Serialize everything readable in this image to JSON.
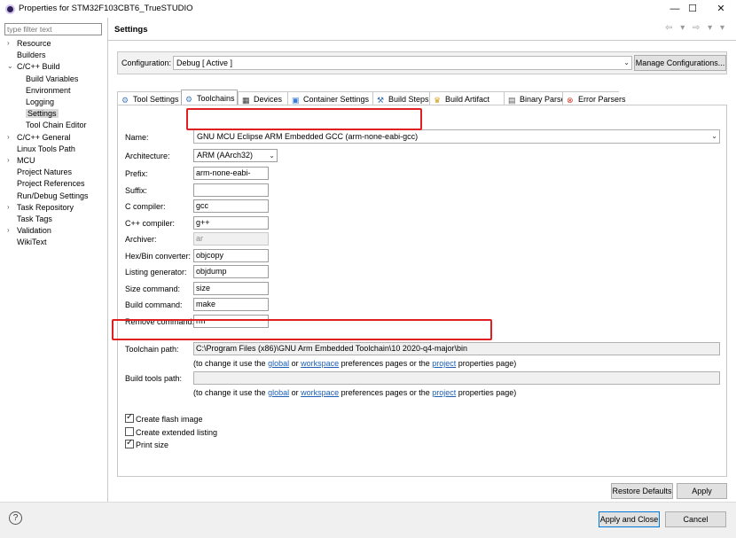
{
  "window": {
    "title": "Properties for STM32F103CBT6_TrueSTUDIO",
    "minimize": "—",
    "maximize": "☐",
    "close": "✕"
  },
  "sidebar": {
    "filter_placeholder": "type filter text",
    "items": [
      {
        "label": "Resource",
        "arrow": "›"
      },
      {
        "label": "Builders",
        "arrow": ""
      },
      {
        "label": "C/C++ Build",
        "arrow": "⌄"
      },
      {
        "label": "Build Variables",
        "arrow": ""
      },
      {
        "label": "Environment",
        "arrow": ""
      },
      {
        "label": "Logging",
        "arrow": ""
      },
      {
        "label": "Settings",
        "arrow": ""
      },
      {
        "label": "Tool Chain Editor",
        "arrow": ""
      },
      {
        "label": "C/C++ General",
        "arrow": "›"
      },
      {
        "label": "Linux Tools Path",
        "arrow": ""
      },
      {
        "label": "MCU",
        "arrow": "›"
      },
      {
        "label": "Project Natures",
        "arrow": ""
      },
      {
        "label": "Project References",
        "arrow": ""
      },
      {
        "label": "Run/Debug Settings",
        "arrow": ""
      },
      {
        "label": "Task Repository",
        "arrow": "›"
      },
      {
        "label": "Task Tags",
        "arrow": ""
      },
      {
        "label": "Validation",
        "arrow": "›"
      },
      {
        "label": "WikiText",
        "arrow": ""
      }
    ]
  },
  "page": {
    "title": "Settings",
    "nav_arrows": "⇦ ▾ ⇨ ▾ ▾"
  },
  "configuration": {
    "label": "Configuration:",
    "value": "Debug  [ Active ]",
    "manage_button": "Manage Configurations..."
  },
  "tabs": [
    {
      "label": "Tool Settings",
      "icon": "gear-icon",
      "color": "#4a7fc1"
    },
    {
      "label": "Toolchains",
      "icon": "gear-icon",
      "color": "#4a7fc1"
    },
    {
      "label": "Devices",
      "icon": "chip-icon",
      "color": "#333333"
    },
    {
      "label": "Container Settings",
      "icon": "container-icon",
      "color": "#3a7bd5"
    },
    {
      "label": "Build Steps",
      "icon": "hammer-icon",
      "color": "#2f6fb0"
    },
    {
      "label": "Build Artifact",
      "icon": "trophy-icon",
      "color": "#d4a017"
    },
    {
      "label": "Binary Parsers",
      "icon": "binary-icon",
      "color": "#555555"
    },
    {
      "label": "Error Parsers",
      "icon": "error-icon",
      "color": "#d33a2c"
    }
  ],
  "toolchain": {
    "name_label": "Name:",
    "name_value": "GNU MCU Eclipse ARM Embedded GCC (arm-none-eabi-gcc)",
    "arch_label": "Architecture:",
    "arch_value": "ARM (AArch32)",
    "fields": [
      {
        "label": "Prefix:",
        "value": "arm-none-eabi-",
        "disabled": false
      },
      {
        "label": "Suffix:",
        "value": "",
        "disabled": false
      },
      {
        "label": "C compiler:",
        "value": "gcc",
        "disabled": false
      },
      {
        "label": "C++ compiler:",
        "value": "g++",
        "disabled": false
      },
      {
        "label": "Archiver:",
        "value": "ar",
        "disabled": true
      },
      {
        "label": "Hex/Bin converter:",
        "value": "objcopy",
        "disabled": false
      },
      {
        "label": "Listing generator:",
        "value": "objdump",
        "disabled": false
      },
      {
        "label": "Size command:",
        "value": "size",
        "disabled": false
      },
      {
        "label": "Build command:",
        "value": "make",
        "disabled": false
      },
      {
        "label": "Remove command:",
        "value": "rm",
        "disabled": false
      }
    ],
    "path_label": "Toolchain path:",
    "path_value": "C:\\Program Files (x86)\\GNU Arm Embedded Toolchain\\10 2020-q4-major\\bin",
    "build_tools_label": "Build tools path:",
    "build_tools_value": "",
    "hint_prefix": "(to change it use the ",
    "hint_global": "global",
    "hint_or": " or ",
    "hint_workspace": "workspace",
    "hint_middle": " preferences pages or the ",
    "hint_project": "project",
    "hint_suffix": " properties page)",
    "checkboxes": [
      {
        "label": "Create flash image",
        "checked": true
      },
      {
        "label": "Create extended listing",
        "checked": false
      },
      {
        "label": "Print size",
        "checked": true
      }
    ]
  },
  "buttons": {
    "restore": "Restore Defaults",
    "apply": "Apply",
    "apply_close": "Apply and Close",
    "cancel": "Cancel"
  },
  "colors": {
    "highlight_box": "#e02020",
    "link": "#1a5fb4"
  }
}
